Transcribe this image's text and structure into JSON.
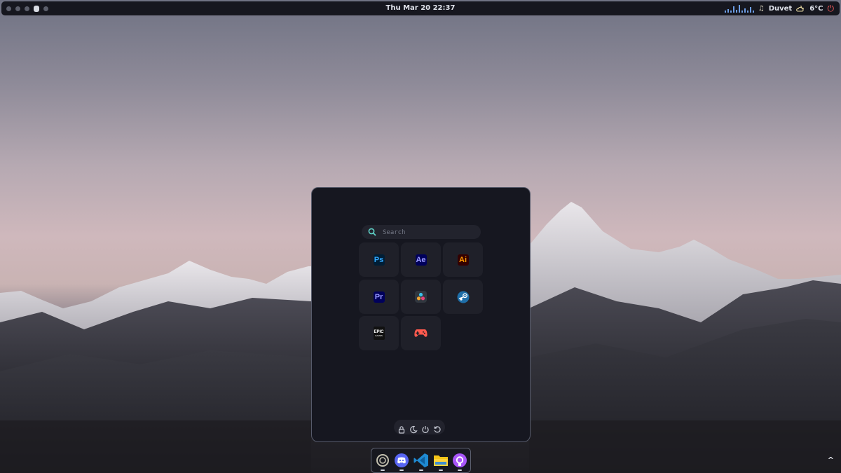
{
  "topbar": {
    "clock": "Thu Mar 20 22:37",
    "music_title": "Duvet",
    "weather_temp": "6°C",
    "workspaces": [
      {
        "active": false
      },
      {
        "active": false
      },
      {
        "active": false
      },
      {
        "active": true
      },
      {
        "active": false
      }
    ],
    "icons": {
      "music": "music-note-icon",
      "weather": "cloud-moon-icon",
      "power": "power-icon"
    }
  },
  "launcher": {
    "search": {
      "placeholder": "Search",
      "value": ""
    },
    "apps": [
      {
        "name": "photoshop",
        "label": "Ps",
        "color": "#31a8ff",
        "bg": "#001e36"
      },
      {
        "name": "after-effects",
        "label": "Ae",
        "color": "#9999ff",
        "bg": "#00005b"
      },
      {
        "name": "illustrator",
        "label": "Ai",
        "color": "#ff9a00",
        "bg": "#330000"
      },
      {
        "name": "premiere-pro",
        "label": "Pr",
        "color": "#9999ff",
        "bg": "#00005b"
      },
      {
        "name": "davinci-resolve",
        "label": "",
        "icon": "davinci-resolve-icon"
      },
      {
        "name": "steam",
        "label": "",
        "icon": "steam-icon"
      },
      {
        "name": "epic-games",
        "label": "EPIC",
        "sublabel": "GAMES",
        "icon": "epic-games-icon"
      },
      {
        "name": "game-launcher",
        "label": "",
        "icon": "gamepad-icon",
        "color": "#ff5a4e"
      }
    ],
    "power_actions": [
      "lock-icon",
      "sleep-moon-icon",
      "power-icon",
      "restart-icon"
    ]
  },
  "dock": {
    "items": [
      "launcher-circle-icon",
      "discord-icon",
      "vscode-icon",
      "files-folder-icon",
      "github-icon"
    ]
  },
  "tray": {
    "chevron": "^"
  }
}
